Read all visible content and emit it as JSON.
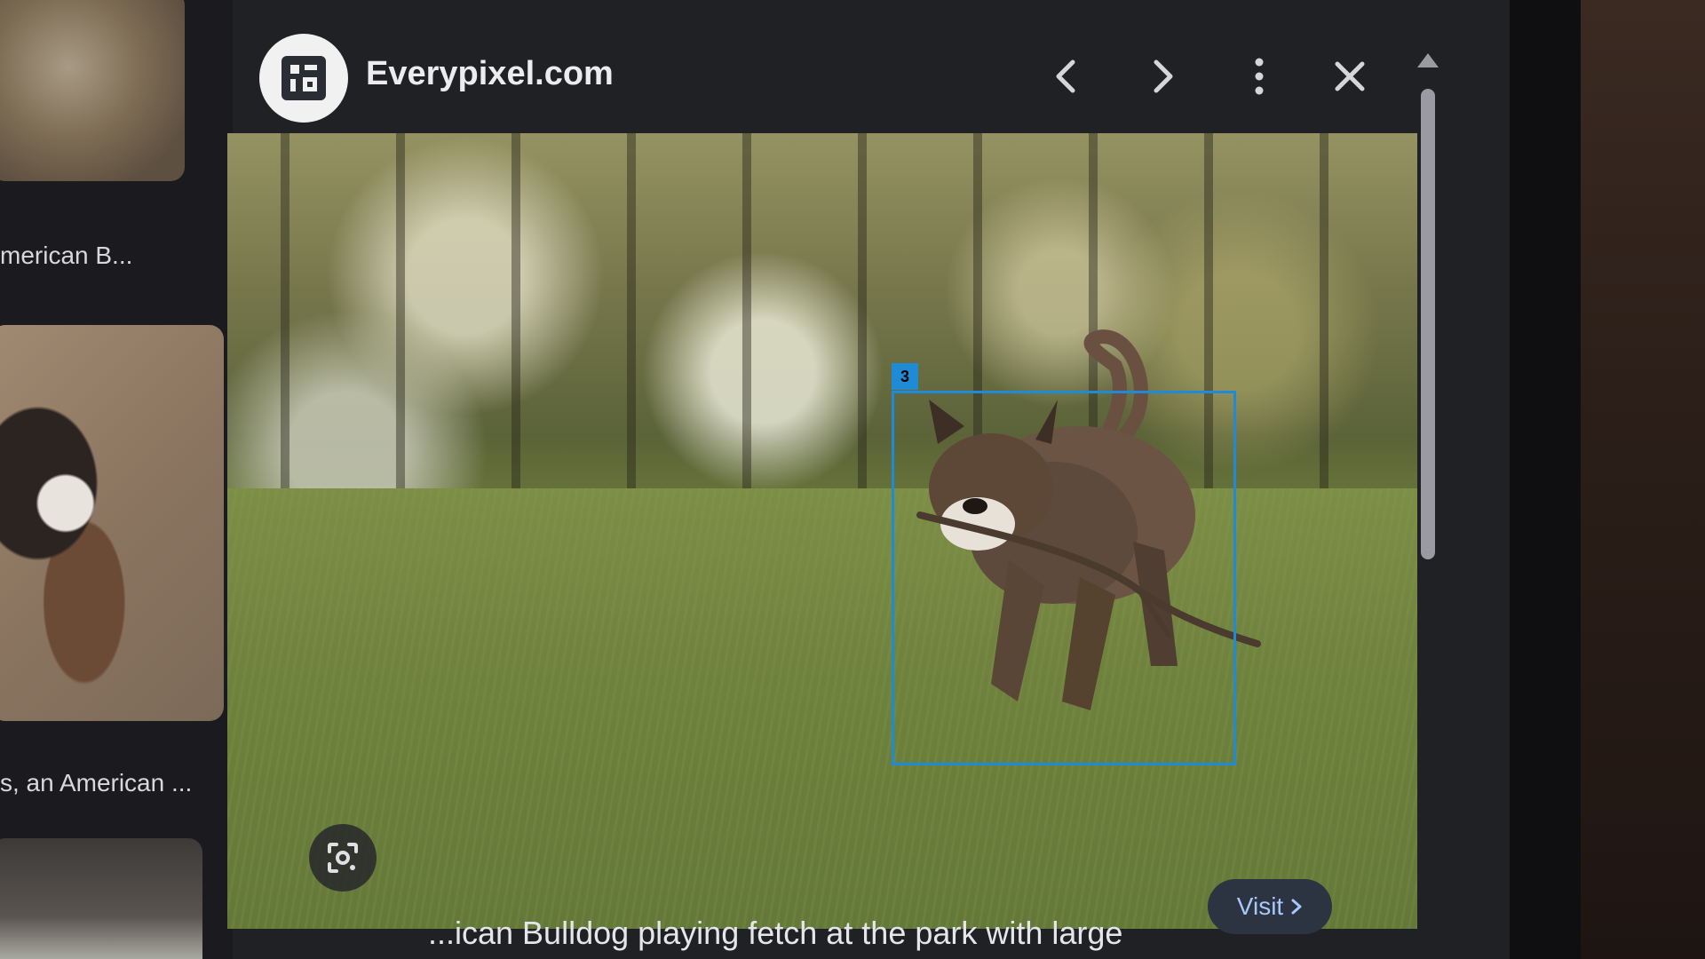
{
  "source": {
    "name": "Everypixel.com"
  },
  "results": {
    "items": [
      {
        "caption": "merican B..."
      },
      {
        "caption": "s, an American ..."
      }
    ]
  },
  "viewer": {
    "detection_label": "3",
    "image_title": "...ican Bulldog playing fetch at the park with large",
    "visit_label": "Visit"
  },
  "icons": {
    "prev": "chevron-left-icon",
    "next": "chevron-right-icon",
    "more": "more-vert-icon",
    "close": "close-icon",
    "lens": "lens-icon",
    "visit_arrow": "chevron-right-icon"
  },
  "colors": {
    "bbox": "#1f8ad6",
    "visit_text": "#a8c7fa",
    "panel_bg": "#202124"
  }
}
